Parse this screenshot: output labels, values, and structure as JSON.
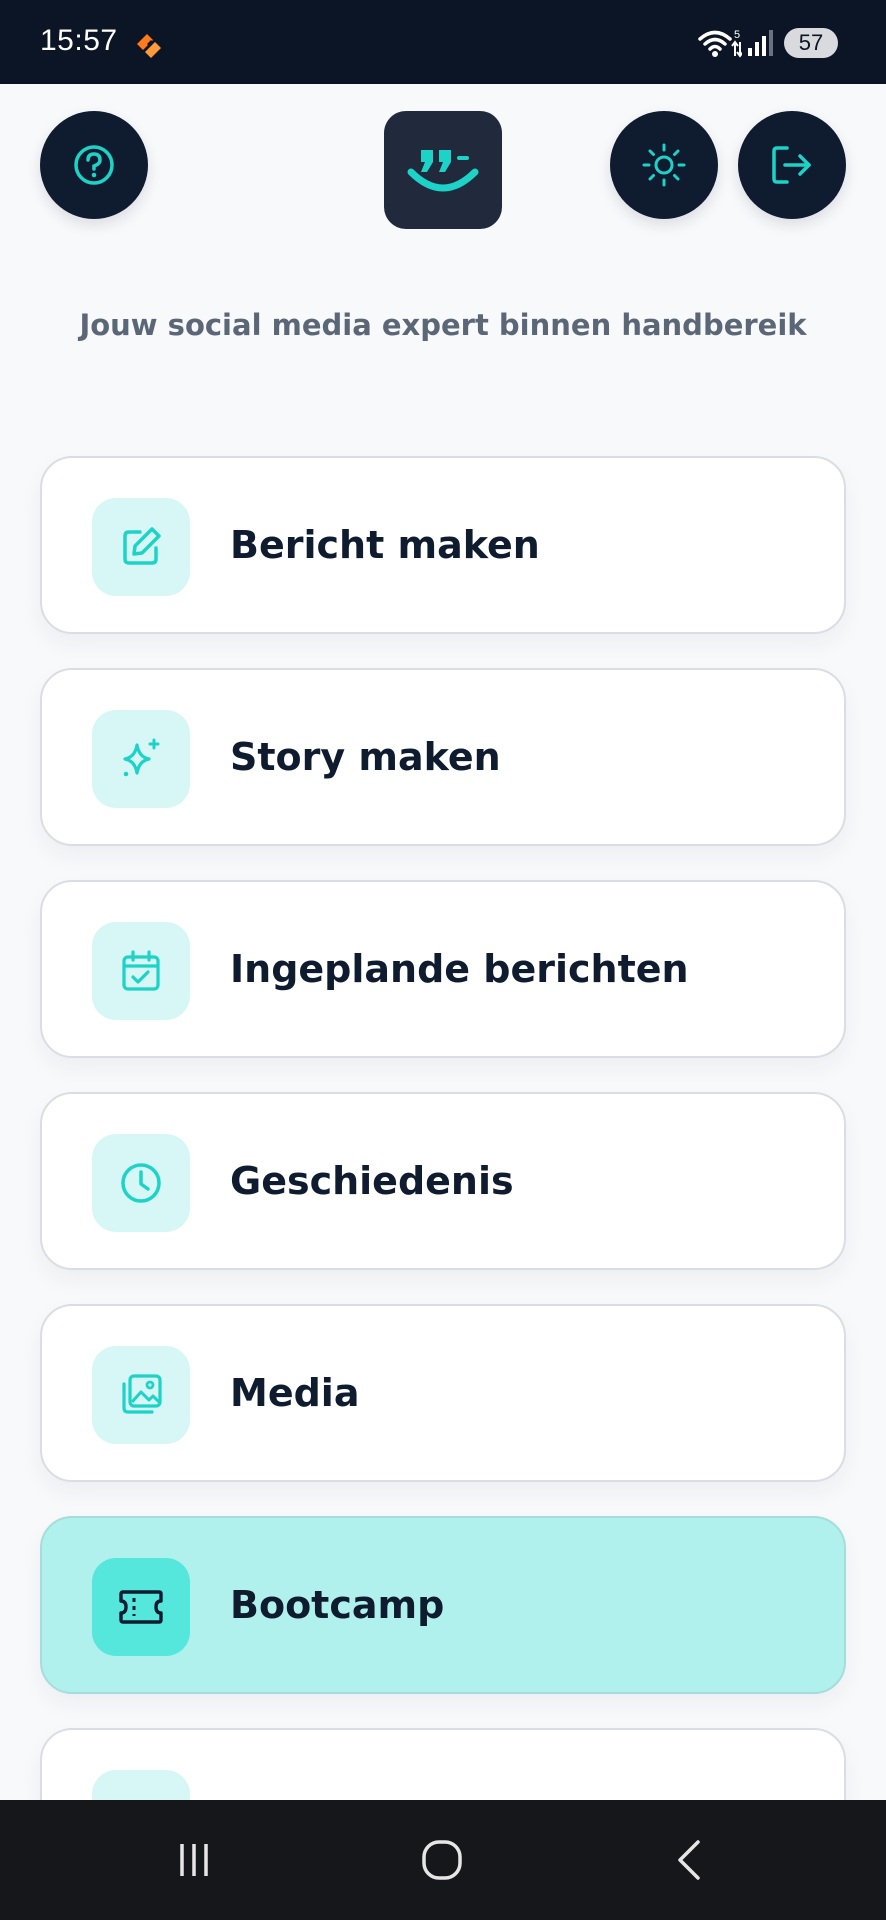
{
  "status_bar": {
    "time": "15:57",
    "battery": "57",
    "network_label": "5"
  },
  "header": {
    "help_icon": "question-circle",
    "theme_icon": "sun",
    "logout_icon": "logout-arrow",
    "logo_icon": "quote-smile-logo"
  },
  "tagline": "Jouw social media expert binnen handbereik",
  "menu": [
    {
      "label": "Bericht maken",
      "icon": "edit-square-icon",
      "active": false
    },
    {
      "label": "Story maken",
      "icon": "sparkles-icon",
      "active": false
    },
    {
      "label": "Ingeplande berichten",
      "icon": "calendar-check-icon",
      "active": false
    },
    {
      "label": "Geschiedenis",
      "icon": "clock-icon",
      "active": false
    },
    {
      "label": "Media",
      "icon": "image-stack-icon",
      "active": false
    },
    {
      "label": "Bootcamp",
      "icon": "ticket-icon",
      "active": true
    }
  ],
  "colors": {
    "accent": "#1dd3c7",
    "dark": "#0f1b2e",
    "active_card": "#b1f1ed"
  }
}
